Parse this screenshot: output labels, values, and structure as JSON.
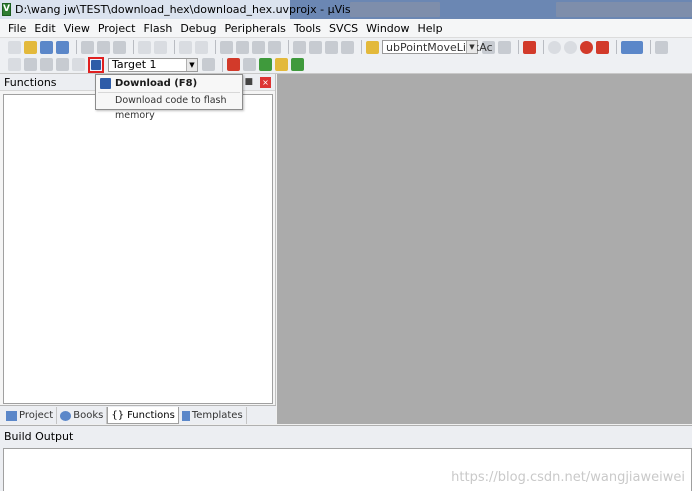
{
  "window": {
    "title": "D:\\wang jw\\TEST\\download_hex\\download_hex.uvprojx - µVision",
    "app_icon_letter": "V"
  },
  "menu": [
    "File",
    "Edit",
    "View",
    "Project",
    "Flash",
    "Debug",
    "Peripherals",
    "Tools",
    "SVCS",
    "Window",
    "Help"
  ],
  "toolbar1": {
    "function_combo_value": "ubPointMoveLinkAc"
  },
  "toolbar2": {
    "target_value": "Target 1"
  },
  "tooltip": {
    "title": "Download (F8)",
    "description": "Download code to flash memory"
  },
  "functions_panel": {
    "title": "Functions",
    "tabs": [
      {
        "label": "Project",
        "icon": "project-icon"
      },
      {
        "label": "Books",
        "icon": "books-icon"
      },
      {
        "label": "Functions",
        "icon": "functions-icon"
      },
      {
        "label": "Templates",
        "icon": "templates-icon"
      }
    ],
    "active_tab": "Functions"
  },
  "build_output": {
    "title": "Build Output"
  },
  "watermark": "https://blog.csdn.net/wangjiaweiwei",
  "colors": {
    "editor_bg": "#ababab",
    "download_highlight": "#e02020",
    "title_bar": "#6b87b3"
  }
}
